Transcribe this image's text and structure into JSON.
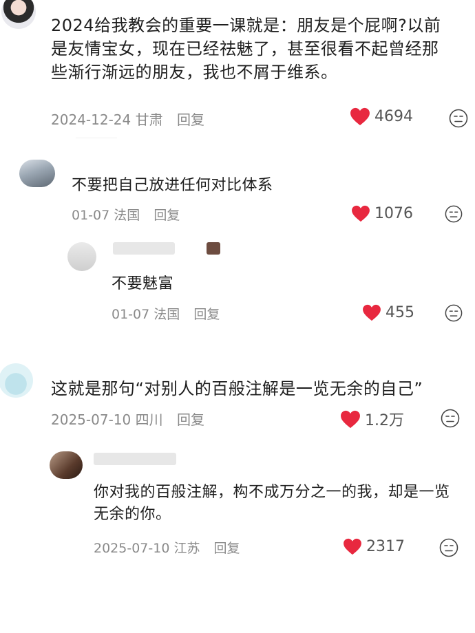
{
  "colors": {
    "like": "#e8283f",
    "meta": "#8a8a8a",
    "text": "#1f1f1f"
  },
  "comments": [
    {
      "text": "2024给我教会的重要一课就是：朋友是个屁啊?以前是友情宝女，现在已经祛魅了，甚至很看不起曾经那些渐行渐远的朋友，我也不屑于维系。",
      "date": "2024-12-24",
      "location": "甘肃",
      "reply_label": "回复",
      "likes": "4694",
      "icon": "heart-icon"
    },
    {
      "text": "不要把自己放进任何对比体系",
      "date": "01-07",
      "location": "法国",
      "reply_label": "回复",
      "likes": "1076"
    },
    {
      "text": "不要魅富",
      "date": "01-07",
      "location": "法国",
      "reply_label": "回复",
      "likes": "455"
    },
    {
      "text": "这就是那句“对别人的百般注解是一览无余的自己”",
      "date": "2025-07-10",
      "location": "四川",
      "reply_label": "回复",
      "likes": "1.2万"
    },
    {
      "text": "你对我的百般注解，构不成万分之一的我，却是一览无余的你。",
      "date": "2025-07-10",
      "location": "江苏",
      "reply_label": "回复",
      "likes": "2317"
    }
  ]
}
